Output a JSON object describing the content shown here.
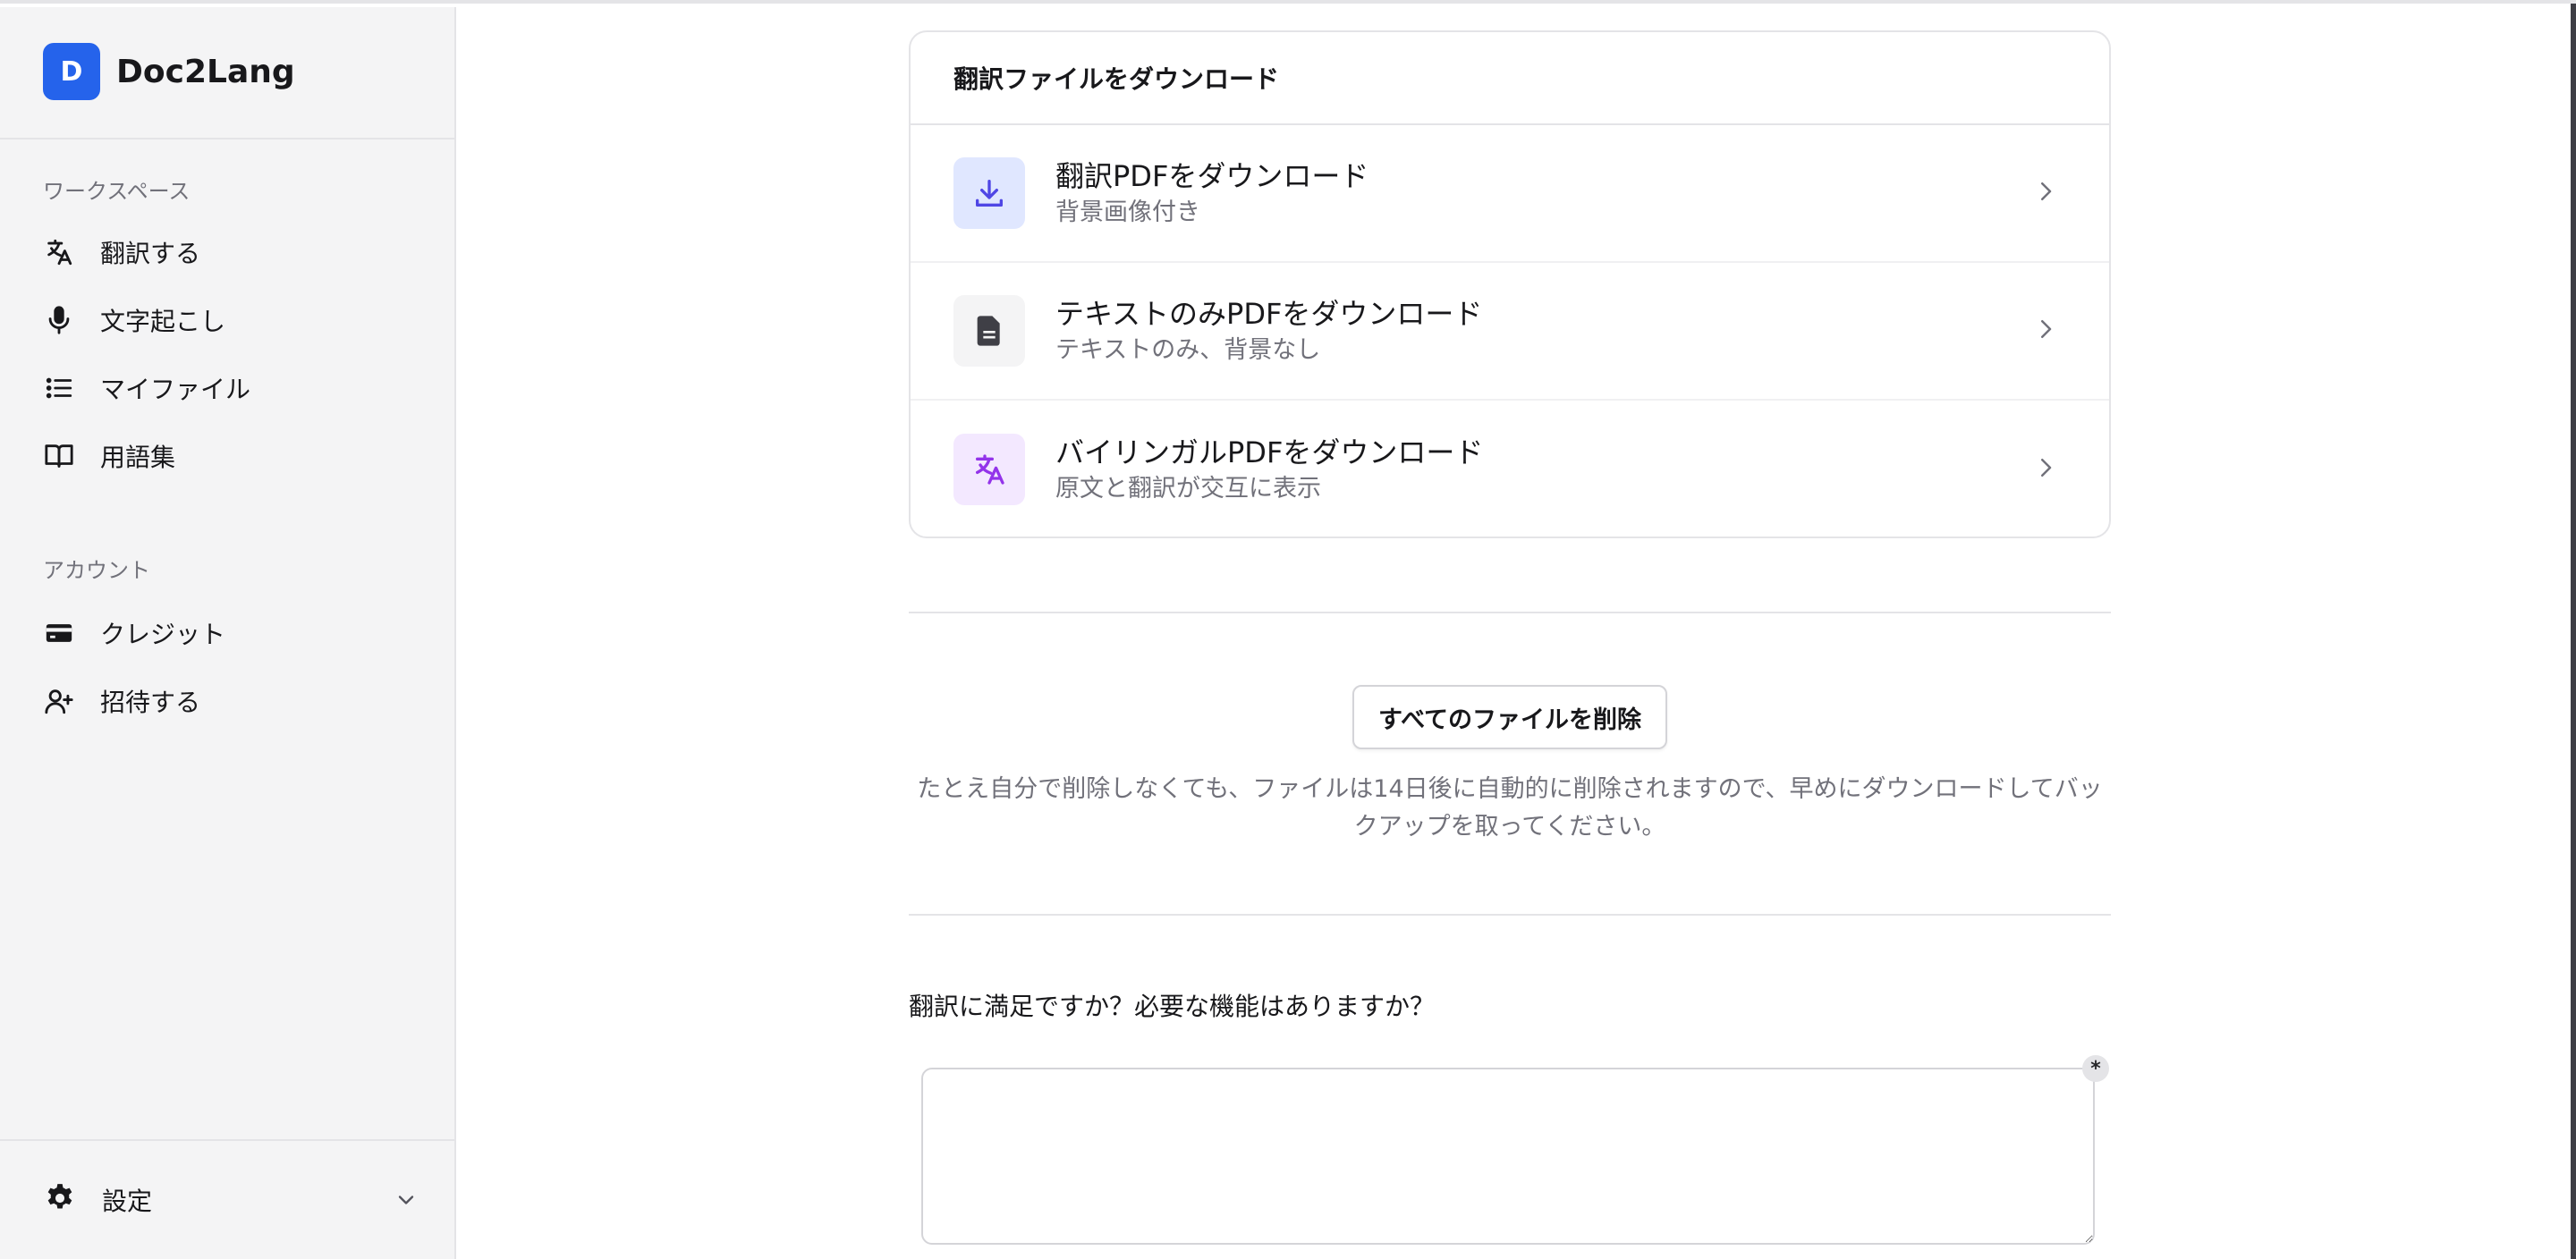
{
  "brand": {
    "logo_letter": "D",
    "name": "Doc2Lang"
  },
  "sidebar": {
    "workspace_label": "ワークスペース",
    "workspace_items": [
      {
        "label": "翻訳する",
        "icon": "translate-icon"
      },
      {
        "label": "文字起こし",
        "icon": "microphone-icon"
      },
      {
        "label": "マイファイル",
        "icon": "list-icon"
      },
      {
        "label": "用語集",
        "icon": "book-icon"
      }
    ],
    "account_label": "アカウント",
    "account_items": [
      {
        "label": "クレジット",
        "icon": "credit-card-icon"
      },
      {
        "label": "招待する",
        "icon": "user-plus-icon"
      }
    ],
    "settings_label": "設定"
  },
  "download_card": {
    "title": "翻訳ファイルをダウンロード",
    "items": [
      {
        "title": "翻訳PDFをダウンロード",
        "subtitle": "背景画像付き",
        "icon": "download-icon",
        "icon_bg": "#e0e7ff",
        "icon_color": "#4f46e5"
      },
      {
        "title": "テキストのみPDFをダウンロード",
        "subtitle": "テキストのみ、背景なし",
        "icon": "document-icon",
        "icon_bg": "#f4f4f5",
        "icon_color": "#3f3f46"
      },
      {
        "title": "バイリンガルPDFをダウンロード",
        "subtitle": "原文と翻訳が交互に表示",
        "icon": "translate-icon",
        "icon_bg": "#f3e8ff",
        "icon_color": "#9333ea"
      }
    ]
  },
  "delete_all_label": "すべてのファイルを削除",
  "notice": "たとえ自分で削除しなくても、ファイルは14日後に自動的に削除されますので、早めにダウンロードしてバックアップを取ってください。",
  "feedback": {
    "question": "翻訳に満足ですか？必要な機能はありますか？",
    "value": "",
    "required_mark": "*"
  },
  "colors": {
    "brand": "#2563eb",
    "sidebar_bg": "#f4f4f5",
    "border": "#e4e4e7",
    "muted_text": "#71717a"
  }
}
